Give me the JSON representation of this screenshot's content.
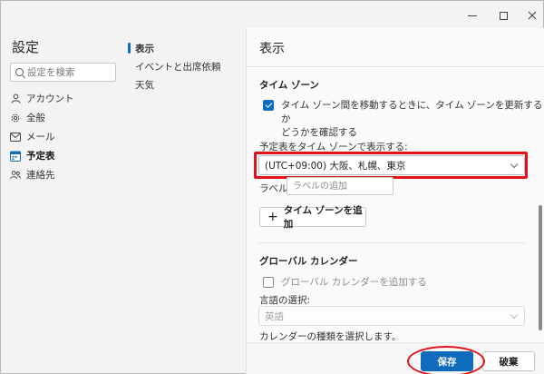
{
  "window": {
    "minimize_icon": "minimize-icon",
    "maximize_icon": "maximize-icon",
    "close_icon": "close-icon"
  },
  "nav": {
    "title": "設定",
    "search_placeholder": "設定を検索",
    "items": [
      {
        "label": "アカウント",
        "icon": "person-icon"
      },
      {
        "label": "全般",
        "icon": "gear-icon"
      },
      {
        "label": "メール",
        "icon": "mail-icon"
      },
      {
        "label": "予定表",
        "icon": "calendar-icon",
        "active": true
      },
      {
        "label": "連絡先",
        "icon": "people-icon"
      }
    ]
  },
  "subnav": {
    "items": [
      {
        "label": "表示",
        "active": true
      },
      {
        "label": "イベントと出席依頼"
      },
      {
        "label": "天気"
      }
    ]
  },
  "content": {
    "title": "表示",
    "timezone": {
      "heading": "タイム ゾーン",
      "update_checkbox_line1": "タイム ゾーン間を移動するときに、タイム ゾーンを更新するか",
      "update_checkbox_line2": "どうかを確認する",
      "update_checked": true,
      "display_label": "予定表をタイム ゾーンで表示する:",
      "display_value": "(UTC+09:00) 大阪、札幌、東京",
      "label_text": "ラベル:",
      "label_placeholder": "ラベルの追加",
      "add_button": "タイム ゾーンを追加"
    },
    "global_calendar": {
      "heading": "グローバル カレンダー",
      "add_checkbox": "グローバル カレンダーを追加する",
      "add_checked": false,
      "language_label": "言語の選択:",
      "language_value": "英語",
      "type_label": "カレンダーの種類を選択します。"
    }
  },
  "footer": {
    "save": "保存",
    "discard": "破棄"
  },
  "colors": {
    "accent": "#0f6cbd",
    "highlight": "#e0131a"
  }
}
